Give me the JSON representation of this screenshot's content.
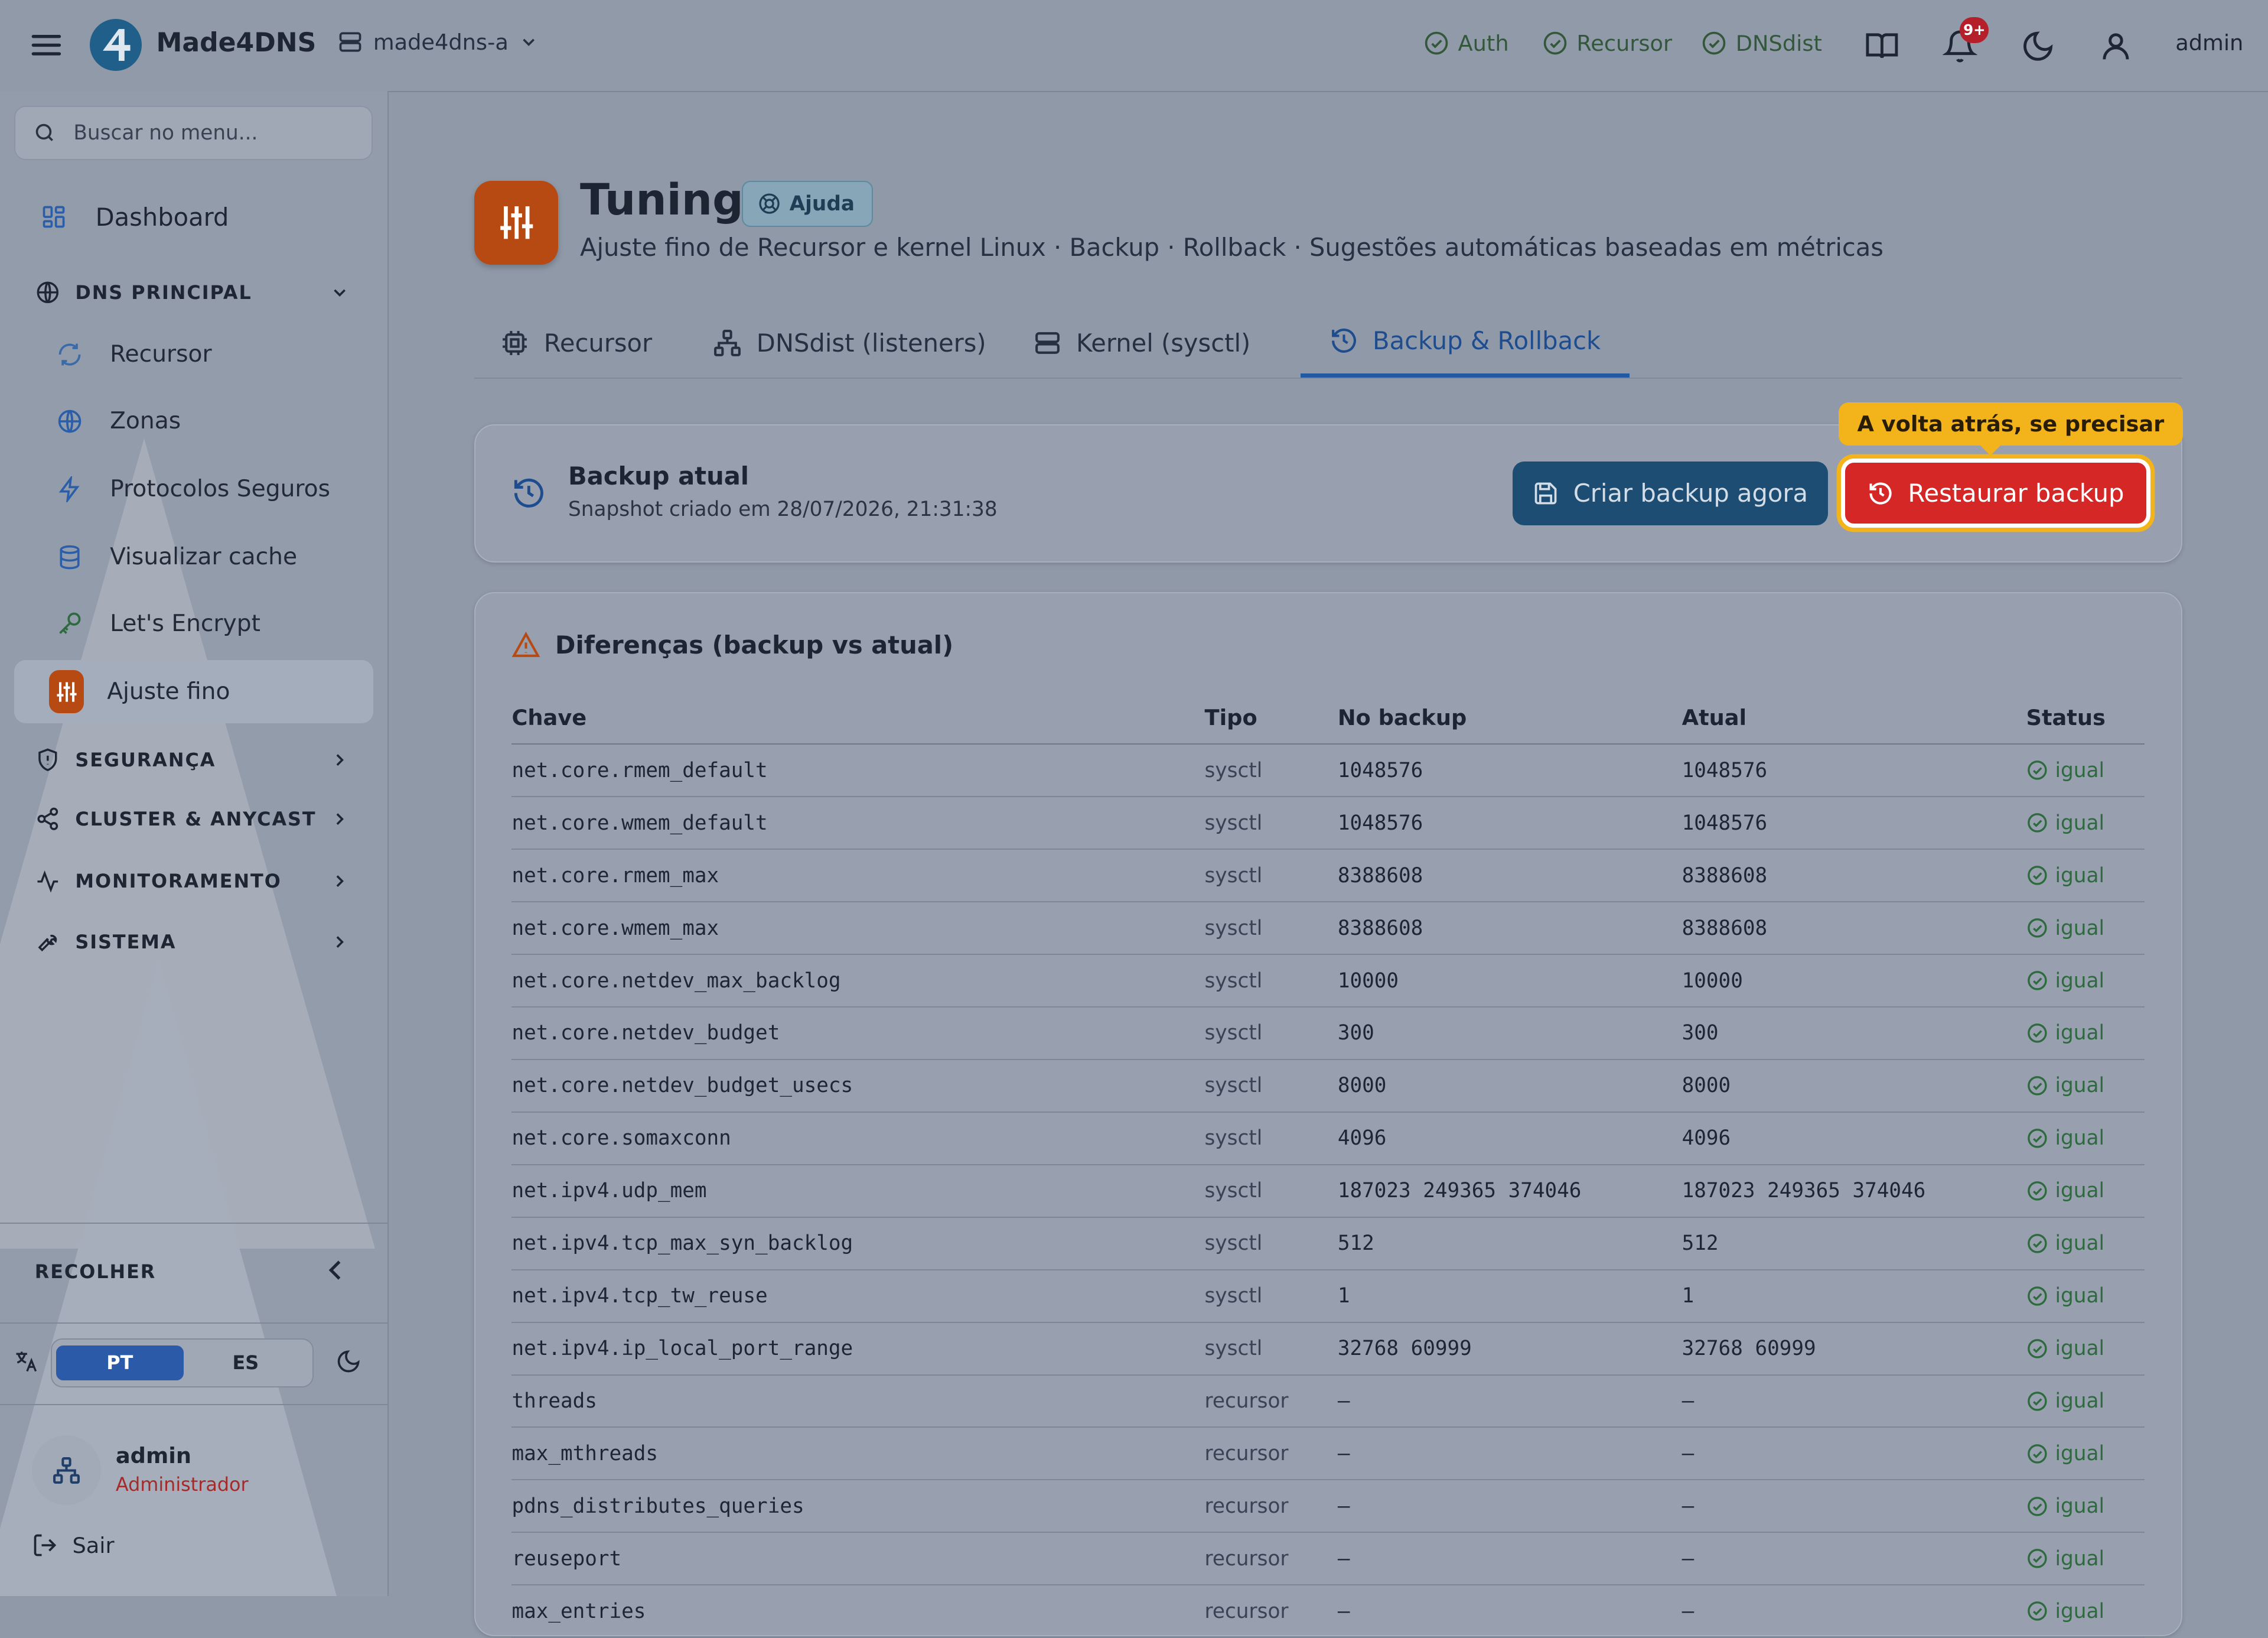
{
  "app": {
    "brand": "Made4DNS",
    "server": "made4dns-a",
    "statuses": [
      {
        "label": "Auth"
      },
      {
        "label": "Recursor"
      },
      {
        "label": "DNSdist"
      }
    ],
    "notif_badge": "9+",
    "user": "admin"
  },
  "sidebar": {
    "search_placeholder": "Buscar no menu...",
    "dashboard": "Dashboard",
    "dns_principal": "DNS PRINCIPAL",
    "items": [
      "Recursor",
      "Zonas",
      "Protocolos Seguros",
      "Visualizar cache",
      "Let's Encrypt",
      "Ajuste fino"
    ],
    "sections": [
      "SEGURANÇA",
      "CLUSTER & ANYCAST",
      "MONITORAMENTO",
      "SISTEMA"
    ],
    "collapse": "RECOLHER",
    "lang_pt": "PT",
    "lang_es": "ES",
    "user_name": "admin",
    "user_role": "Administrador",
    "logout": "Sair"
  },
  "page": {
    "title": "Tuning",
    "help": "Ajuda",
    "subtitle": "Ajuste fino de Recursor e kernel Linux · Backup · Rollback · Sugestões automáticas baseadas em métricas",
    "tabs": [
      "Recursor",
      "DNSdist (listeners)",
      "Kernel (sysctl)",
      "Backup & Rollback"
    ],
    "active_tab": "Backup & Rollback"
  },
  "backup": {
    "title": "Backup atual",
    "snapshot_prefix": "Snapshot criado em",
    "snapshot_time": "28/07/2026, 21:31:38",
    "create_label": "Criar backup agora",
    "restore_label": "Restaurar backup",
    "callout": "A volta atrás, se precisar"
  },
  "diff": {
    "title": "Diferenças (backup vs atual)",
    "columns": [
      "Chave",
      "Tipo",
      "No backup",
      "Atual",
      "Status"
    ],
    "rows": [
      {
        "key": "net.core.rmem_default",
        "type": "sysctl",
        "backup": "1048576",
        "current": "1048576",
        "status": "igual"
      },
      {
        "key": "net.core.wmem_default",
        "type": "sysctl",
        "backup": "1048576",
        "current": "1048576",
        "status": "igual"
      },
      {
        "key": "net.core.rmem_max",
        "type": "sysctl",
        "backup": "8388608",
        "current": "8388608",
        "status": "igual"
      },
      {
        "key": "net.core.wmem_max",
        "type": "sysctl",
        "backup": "8388608",
        "current": "8388608",
        "status": "igual"
      },
      {
        "key": "net.core.netdev_max_backlog",
        "type": "sysctl",
        "backup": "10000",
        "current": "10000",
        "status": "igual"
      },
      {
        "key": "net.core.netdev_budget",
        "type": "sysctl",
        "backup": "300",
        "current": "300",
        "status": "igual"
      },
      {
        "key": "net.core.netdev_budget_usecs",
        "type": "sysctl",
        "backup": "8000",
        "current": "8000",
        "status": "igual"
      },
      {
        "key": "net.core.somaxconn",
        "type": "sysctl",
        "backup": "4096",
        "current": "4096",
        "status": "igual"
      },
      {
        "key": "net.ipv4.udp_mem",
        "type": "sysctl",
        "backup": "187023 249365 374046",
        "current": "187023 249365 374046",
        "status": "igual"
      },
      {
        "key": "net.ipv4.tcp_max_syn_backlog",
        "type": "sysctl",
        "backup": "512",
        "current": "512",
        "status": "igual"
      },
      {
        "key": "net.ipv4.tcp_tw_reuse",
        "type": "sysctl",
        "backup": "1",
        "current": "1",
        "status": "igual"
      },
      {
        "key": "net.ipv4.ip_local_port_range",
        "type": "sysctl",
        "backup": "32768 60999",
        "current": "32768 60999",
        "status": "igual"
      },
      {
        "key": "threads",
        "type": "recursor",
        "backup": "—",
        "current": "—",
        "status": "igual"
      },
      {
        "key": "max_mthreads",
        "type": "recursor",
        "backup": "—",
        "current": "—",
        "status": "igual"
      },
      {
        "key": "pdns_distributes_queries",
        "type": "recursor",
        "backup": "—",
        "current": "—",
        "status": "igual"
      },
      {
        "key": "reuseport",
        "type": "recursor",
        "backup": "—",
        "current": "—",
        "status": "igual"
      },
      {
        "key": "max_entries",
        "type": "recursor",
        "backup": "—",
        "current": "—",
        "status": "igual"
      }
    ]
  },
  "colors": {
    "accent": "#2358a3",
    "danger": "#d62727",
    "highlight": "#f3b31b",
    "ok": "#2d6a3e",
    "tuning_icon": "#b64a12"
  }
}
